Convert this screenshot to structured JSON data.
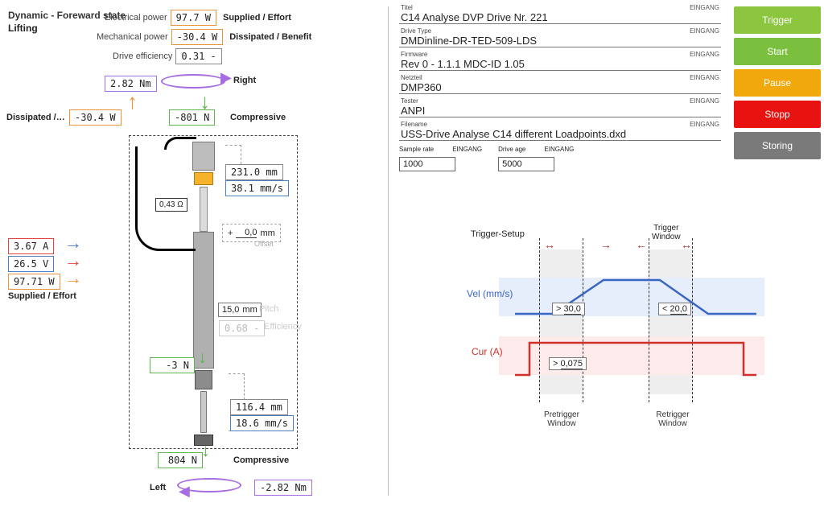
{
  "state": {
    "title": "Dynamic - Foreward state",
    "sub": "Lifting"
  },
  "power": {
    "elec_lbl": "Electrical power",
    "elec": "97.7 W",
    "elec_desc": "Supplied / Effort",
    "mech_lbl": "Mechanical power",
    "mech": "-30.4 W",
    "mech_desc": "Dissipated / Benefit",
    "eff_lbl": "Drive efficiency",
    "eff": "0.31 -"
  },
  "torque_top": "2.82 Nm",
  "dir_right": "Right",
  "dissipated_lbl": "Dissipated /…",
  "dissipated_val": "-30.4 W",
  "force_top": "-801 N",
  "compressive": "Compressive",
  "pos1": "231.0 mm",
  "vel1": "38.1 mm/s",
  "offset_val": "0,0",
  "offset_unit": "mm",
  "offset_lbl": "Offset",
  "plus": "+",
  "pitch_val": "15,0",
  "pitch_unit": "mm",
  "pitch_lbl": "Pitch",
  "eff2_val": "0.68 -",
  "eff2_lbl": "Efficiency",
  "inputs": {
    "current": "3.67 A",
    "voltage": "26.5 V",
    "power": "97.71 W",
    "supplied_lbl": "Supplied / Effort"
  },
  "resist": "0,43 Ω",
  "force_mid": "-3 N",
  "pos2": "116.4 mm",
  "vel2": "18.6 mm/s",
  "force_bot": "804 N",
  "dir_left": "Left",
  "torque_bot": "-2.82 Nm",
  "form": {
    "tag": "EINGANG",
    "title_lbl": "Titel",
    "title": "C14 Analyse DVP Drive Nr. 221",
    "type_lbl": "Drive Type",
    "type": "DMDinline-DR-TED-509-LDS",
    "fw_lbl": "Firmware",
    "fw": "Rev 0 - 1.1.1 MDC-ID 1.05",
    "psu_lbl": "Netzteil",
    "psu": "DMP360",
    "tester_lbl": "Tester",
    "tester": "ANPI",
    "file_lbl": "Filename",
    "file": "USS-Drive Analyse C14 different Loadpoints.dxd",
    "sr_lbl": "Sample rate",
    "sr": "1000",
    "age_lbl": "Drive age",
    "age": "5000"
  },
  "buttons": {
    "trigger": "Trigger",
    "start": "Start",
    "pause": "Pause",
    "stop": "Stopp",
    "store": "Storing"
  },
  "trigger": {
    "title": "Trigger-Setup",
    "win_lbl": "Trigger\nWindow",
    "vel_lbl": "Vel (mm/s)",
    "cur_lbl": "Cur (A)",
    "vel_gt": "30,0",
    "vel_lt": "20,0",
    "cur_gt": "0,075",
    "pre_lbl": "Pretrigger\nWindow",
    "re_lbl": "Retrigger\nWindow",
    "gt": ">",
    "lt": "<"
  }
}
